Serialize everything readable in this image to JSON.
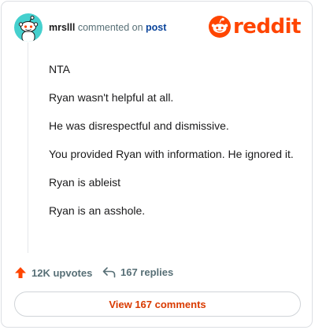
{
  "header": {
    "username": "mrslll",
    "action_text": "commented on",
    "post_link": "post",
    "logo_text": "reddit"
  },
  "comment": {
    "paragraphs": [
      "NTA",
      "Ryan wasn't helpful at all.",
      "He was disrespectful and dismissive.",
      "You provided Ryan with information. He ignored it.",
      "Ryan is ableist",
      "Ryan is an asshole."
    ]
  },
  "actions": {
    "upvotes": "12K upvotes",
    "replies": "167 replies"
  },
  "footer": {
    "view_button": "View 167 comments"
  },
  "icons": {
    "avatar": "snoo-avatar-icon",
    "logo": "reddit-snoo-icon",
    "upvote": "upvote-arrow-icon",
    "reply": "reply-arrow-icon"
  },
  "colors": {
    "brand": "#ff4500",
    "upvote": "#ff4500",
    "link": "#0a449b",
    "button_text": "#d93a00",
    "avatar_bg": "#45d0ce"
  }
}
